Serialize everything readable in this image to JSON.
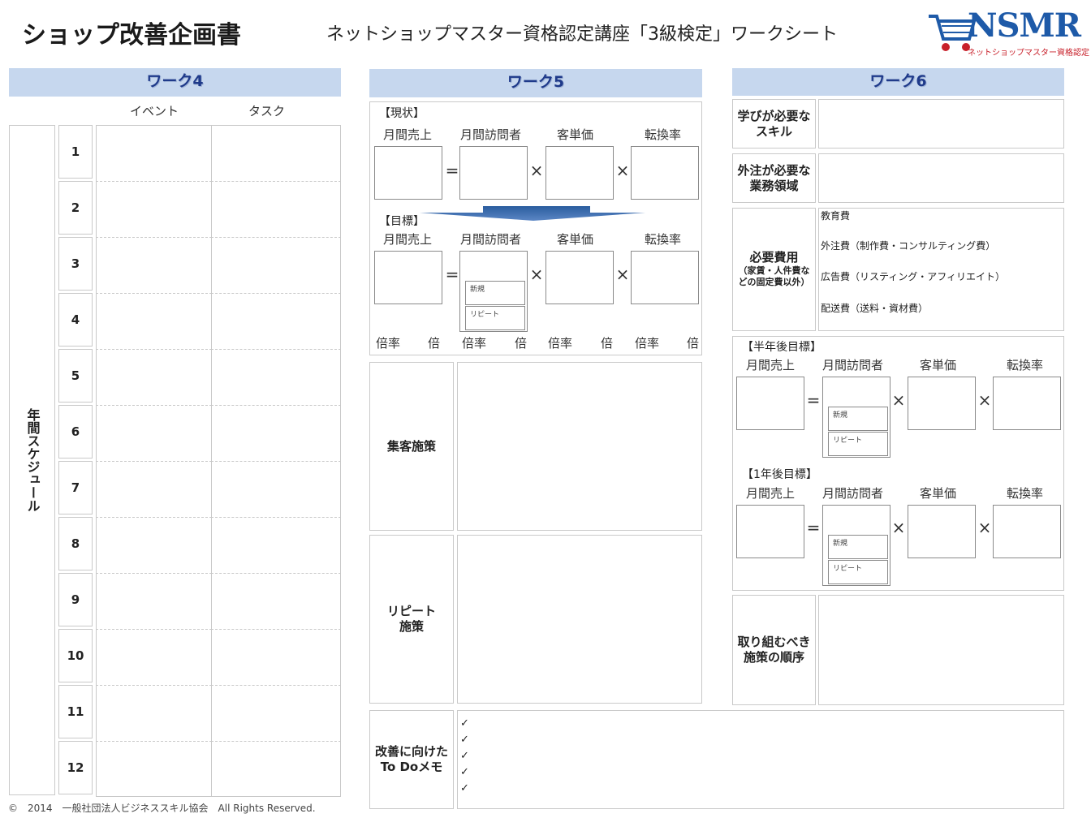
{
  "header": {
    "title": "ショップ改善企画書",
    "subtitle": "ネットショップマスター資格認定講座「3級検定」ワークシート",
    "logo_text": "NSMR",
    "logo_sub": "ネットショップマスター資格認定"
  },
  "work4": {
    "title": "ワーク4",
    "col_event": "イベント",
    "col_task": "タスク",
    "side_label": "年間スケジュール",
    "months": [
      "1",
      "2",
      "3",
      "4",
      "5",
      "6",
      "7",
      "8",
      "9",
      "10",
      "11",
      "12"
    ]
  },
  "work5": {
    "title": "ワーク5",
    "current_label": "【現状】",
    "target_label": "【目標】",
    "cols": [
      "月間売上",
      "月間訪問者",
      "客単価",
      "転換率"
    ],
    "equals": "=",
    "times": "×",
    "new_label": "新規",
    "repeat_label": "リピート",
    "rate_label": "倍率",
    "rate_unit": "倍",
    "acquisition": "集客施策",
    "repeat_measure_line1": "リピート",
    "repeat_measure_line2": "施策",
    "todo_line1": "改善に向けた",
    "todo_line2": "To Doメモ",
    "todo_checks": [
      "✓",
      "✓",
      "✓",
      "✓",
      "✓"
    ]
  },
  "work6": {
    "title": "ワーク6",
    "skills_line1": "学びが必要な",
    "skills_line2": "スキル",
    "outsource_line1": "外注が必要な",
    "outsource_line2": "業務領域",
    "cost_title": "必要費用",
    "cost_note_line1": "（家賃・人件費な",
    "cost_note_line2": "どの固定費以外）",
    "cost_items": [
      "教育費",
      "外注費（制作費・コンサルティング費）",
      "広告費（リスティング・アフィリエイト）",
      "配送費（送料・資材費）"
    ],
    "half_year": "【半年後目標】",
    "one_year": "【1年後目標】",
    "order_line1": "取り組むべき",
    "order_line2": "施策の順序"
  },
  "footer": {
    "copyright": "©　2014　一般社団法人ビジネススキル協会　All Rights Reserved."
  },
  "colors": {
    "header_band": "#c6d7ee",
    "header_text": "#1f3a8a",
    "logo_blue": "#1e5aa8",
    "logo_red": "#c8202a"
  }
}
